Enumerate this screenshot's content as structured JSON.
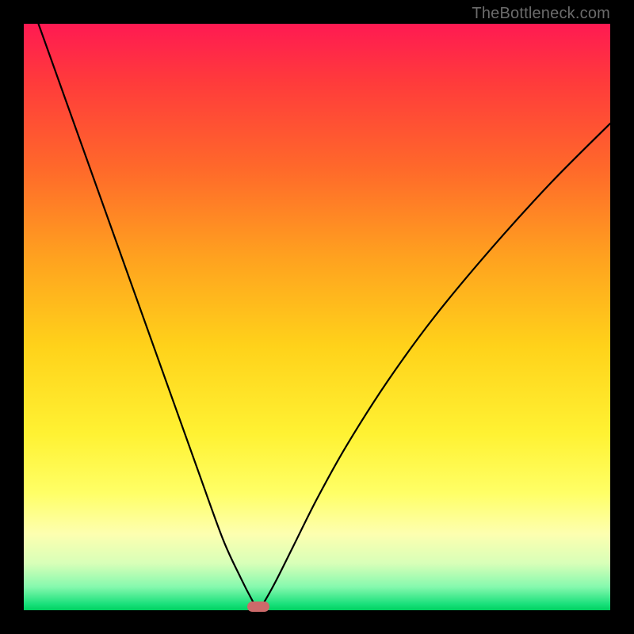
{
  "watermark": "TheBottleneck.com",
  "colors": {
    "frame": "#000000",
    "curve": "#000000",
    "marker": "#cc6a6a"
  },
  "chart_data": {
    "type": "line",
    "title": "",
    "xlabel": "",
    "ylabel": "",
    "xlim": [
      0,
      100
    ],
    "ylim": [
      0,
      100
    ],
    "grid": false,
    "legend": false,
    "x_min_marker": 40,
    "series": [
      {
        "name": "bottleneck-curve",
        "x": [
          0,
          5,
          10,
          15,
          20,
          25,
          30,
          34,
          37,
          39,
          40,
          41,
          43,
          46,
          50,
          55,
          62,
          70,
          80,
          90,
          100
        ],
        "y": [
          107,
          93,
          79,
          65,
          51,
          37,
          23,
          12,
          5.5,
          1.6,
          0,
          1.4,
          5,
          11,
          19,
          28,
          39,
          50,
          62,
          73,
          83
        ]
      }
    ],
    "background_gradient": {
      "direction": "vertical",
      "stops": [
        {
          "pct": 0,
          "color": "#ff1a52"
        },
        {
          "pct": 25,
          "color": "#ff6a2a"
        },
        {
          "pct": 55,
          "color": "#ffd21a"
        },
        {
          "pct": 80,
          "color": "#ffff66"
        },
        {
          "pct": 96,
          "color": "#86f9ae"
        },
        {
          "pct": 100,
          "color": "#00d060"
        }
      ]
    }
  }
}
